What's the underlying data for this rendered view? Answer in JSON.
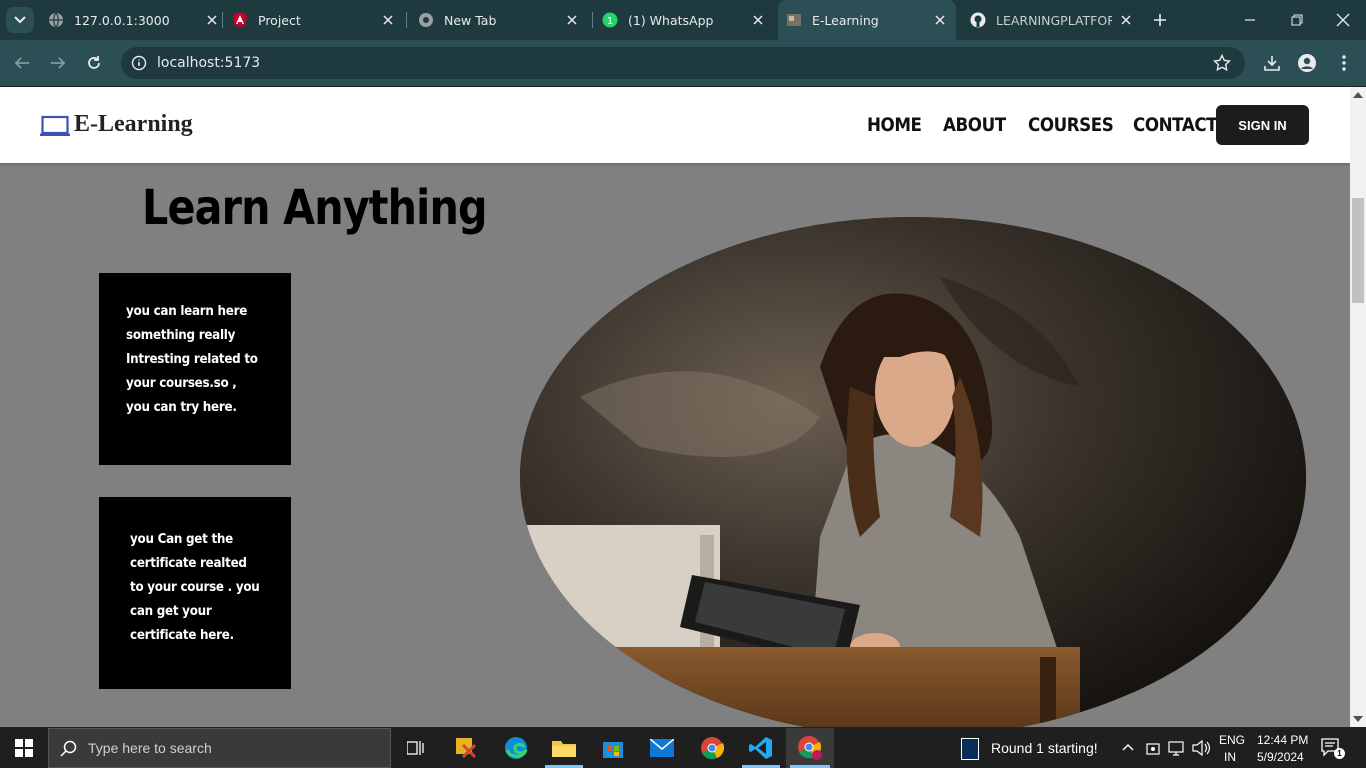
{
  "browser": {
    "tabs": [
      {
        "title": "127.0.0.1:3000"
      },
      {
        "title": "Project"
      },
      {
        "title": "New Tab"
      },
      {
        "title": "(1) WhatsApp"
      },
      {
        "title": "E-Learning"
      },
      {
        "title": "LEARNINGPLATFORM"
      }
    ],
    "url": "localhost:5173"
  },
  "site": {
    "logo": "E-Learning",
    "nav": [
      "HOME",
      "ABOUT",
      "COURSES",
      "CONTACT"
    ],
    "signin": "SIGN IN",
    "hero_title": "Learn Anything",
    "card1": [
      "you can learn here",
      "something really",
      "Intresting related to",
      "your courses.so ,",
      "you can try here."
    ],
    "card2": [
      "you Can get the",
      "certificate realted",
      "to your course . you",
      "can get your",
      "certificate here."
    ]
  },
  "taskbar": {
    "search_placeholder": "Type here to search",
    "notification": "Round 1 starting!",
    "lang1": "ENG",
    "lang2": "IN",
    "time": "12:44 PM",
    "date": "5/9/2024"
  },
  "colors": {
    "tabbar": "#1e3a3f",
    "toolbar": "#2b4f55",
    "page_bg": "#808080",
    "card_bg": "#000000"
  }
}
